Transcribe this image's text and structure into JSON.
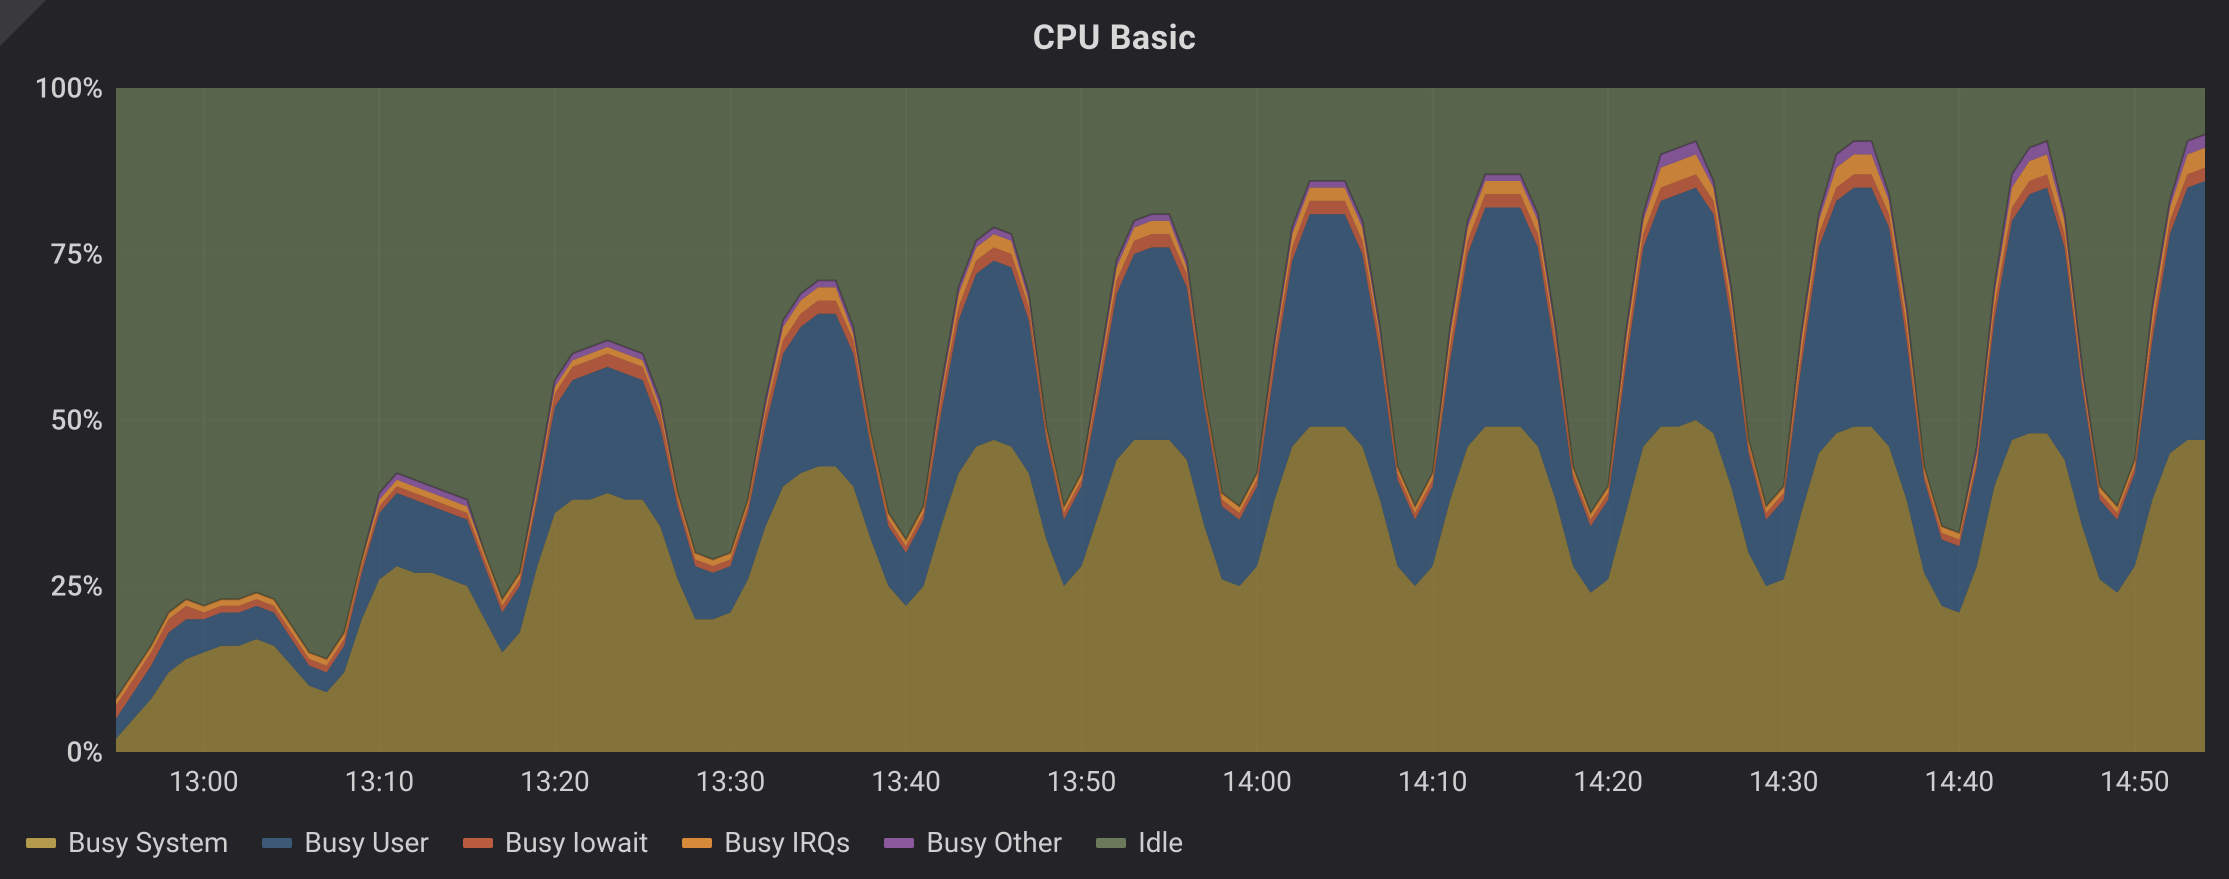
{
  "title": "CPU Basic",
  "legend": [
    {
      "name": "Busy System",
      "color": "#b39a4c"
    },
    {
      "name": "Busy User",
      "color": "#3c5a78"
    },
    {
      "name": "Busy Iowait",
      "color": "#b95b3f"
    },
    {
      "name": "Busy IRQs",
      "color": "#d78a3a"
    },
    {
      "name": "Busy Other",
      "color": "#8a5a9c"
    },
    {
      "name": "Idle",
      "color": "#6b7a5a"
    }
  ],
  "y_ticks": [
    "0%",
    "25%",
    "50%",
    "75%",
    "100%"
  ],
  "x_ticks": [
    "13:00",
    "13:10",
    "13:20",
    "13:30",
    "13:40",
    "13:50",
    "14:00",
    "14:10",
    "14:20",
    "14:30",
    "14:40",
    "14:50"
  ],
  "chart_data": {
    "type": "area",
    "title": "CPU Basic",
    "xlabel": "",
    "ylabel": "",
    "ylim": [
      0,
      100
    ],
    "stacked": true,
    "x": [
      "12:55",
      "12:56",
      "12:57",
      "12:58",
      "12:59",
      "13:00",
      "13:01",
      "13:02",
      "13:03",
      "13:04",
      "13:05",
      "13:06",
      "13:07",
      "13:08",
      "13:09",
      "13:10",
      "13:11",
      "13:12",
      "13:13",
      "13:14",
      "13:15",
      "13:16",
      "13:17",
      "13:18",
      "13:19",
      "13:20",
      "13:21",
      "13:22",
      "13:23",
      "13:24",
      "13:25",
      "13:26",
      "13:27",
      "13:28",
      "13:29",
      "13:30",
      "13:31",
      "13:32",
      "13:33",
      "13:34",
      "13:35",
      "13:36",
      "13:37",
      "13:38",
      "13:39",
      "13:40",
      "13:41",
      "13:42",
      "13:43",
      "13:44",
      "13:45",
      "13:46",
      "13:47",
      "13:48",
      "13:49",
      "13:50",
      "13:51",
      "13:52",
      "13:53",
      "13:54",
      "13:55",
      "13:56",
      "13:57",
      "13:58",
      "13:59",
      "14:00",
      "14:01",
      "14:02",
      "14:03",
      "14:04",
      "14:05",
      "14:06",
      "14:07",
      "14:08",
      "14:09",
      "14:10",
      "14:11",
      "14:12",
      "14:13",
      "14:14",
      "14:15",
      "14:16",
      "14:17",
      "14:18",
      "14:19",
      "14:20",
      "14:21",
      "14:22",
      "14:23",
      "14:24",
      "14:25",
      "14:26",
      "14:27",
      "14:28",
      "14:29",
      "14:30",
      "14:31",
      "14:32",
      "14:33",
      "14:34",
      "14:35",
      "14:36",
      "14:37",
      "14:38",
      "14:39",
      "14:40",
      "14:41",
      "14:42",
      "14:43",
      "14:44",
      "14:45",
      "14:46",
      "14:47",
      "14:48",
      "14:49",
      "14:50",
      "14:51",
      "14:52",
      "14:53",
      "14:54"
    ],
    "series": [
      {
        "name": "Busy System",
        "color": "#8c7a3c",
        "values": [
          2,
          5,
          8,
          12,
          14,
          15,
          16,
          16,
          17,
          16,
          13,
          10,
          9,
          12,
          20,
          26,
          28,
          27,
          27,
          26,
          25,
          20,
          15,
          18,
          28,
          36,
          38,
          38,
          39,
          38,
          38,
          34,
          26,
          20,
          20,
          21,
          26,
          34,
          40,
          42,
          43,
          43,
          40,
          32,
          25,
          22,
          25,
          34,
          42,
          46,
          47,
          46,
          42,
          32,
          25,
          28,
          36,
          44,
          47,
          47,
          47,
          44,
          34,
          26,
          25,
          28,
          38,
          46,
          49,
          49,
          49,
          46,
          38,
          28,
          25,
          28,
          38,
          46,
          49,
          49,
          49,
          46,
          38,
          28,
          24,
          26,
          36,
          46,
          49,
          49,
          50,
          48,
          40,
          30,
          25,
          26,
          36,
          45,
          48,
          49,
          49,
          46,
          38,
          27,
          22,
          21,
          28,
          40,
          47,
          48,
          48,
          44,
          34,
          26,
          24,
          28,
          38,
          45,
          47,
          47
        ]
      },
      {
        "name": "Busy User",
        "color": "#3c5a78",
        "values": [
          3,
          4,
          5,
          6,
          6,
          5,
          5,
          5,
          5,
          5,
          4,
          3,
          3,
          4,
          7,
          10,
          11,
          11,
          10,
          10,
          10,
          8,
          6,
          7,
          10,
          16,
          18,
          19,
          19,
          19,
          18,
          15,
          11,
          8,
          7,
          7,
          10,
          15,
          20,
          22,
          23,
          23,
          20,
          14,
          9,
          8,
          10,
          17,
          23,
          26,
          27,
          27,
          23,
          15,
          10,
          12,
          18,
          25,
          28,
          29,
          29,
          26,
          18,
          11,
          10,
          12,
          20,
          28,
          32,
          32,
          32,
          29,
          22,
          13,
          10,
          12,
          21,
          29,
          33,
          33,
          33,
          30,
          22,
          13,
          10,
          12,
          22,
          30,
          34,
          35,
          35,
          33,
          25,
          15,
          10,
          12,
          22,
          31,
          35,
          36,
          36,
          33,
          24,
          14,
          10,
          10,
          15,
          25,
          33,
          36,
          37,
          32,
          21,
          12,
          11,
          14,
          24,
          33,
          38,
          39
        ]
      },
      {
        "name": "Busy Iowait",
        "color": "#b95b3f",
        "values": [
          2,
          2,
          2,
          2,
          2,
          1,
          1,
          1,
          1,
          1,
          1,
          1,
          1,
          1,
          1,
          1,
          1,
          1,
          1,
          1,
          1,
          1,
          1,
          1,
          1,
          2,
          2,
          2,
          2,
          2,
          2,
          2,
          1,
          1,
          1,
          1,
          1,
          2,
          2,
          2,
          2,
          2,
          2,
          1,
          1,
          1,
          1,
          2,
          2,
          2,
          2,
          2,
          2,
          1,
          1,
          1,
          2,
          2,
          2,
          2,
          2,
          2,
          1,
          1,
          1,
          1,
          2,
          2,
          2,
          2,
          2,
          2,
          2,
          1,
          1,
          1,
          2,
          2,
          2,
          2,
          2,
          2,
          2,
          1,
          1,
          1,
          2,
          2,
          2,
          2,
          2,
          2,
          2,
          1,
          1,
          1,
          2,
          2,
          2,
          2,
          2,
          2,
          2,
          1,
          1,
          1,
          1,
          2,
          2,
          2,
          2,
          2,
          1,
          1,
          1,
          1,
          2,
          2,
          2,
          2
        ]
      },
      {
        "name": "Busy IRQs",
        "color": "#d78a3a",
        "values": [
          1,
          1,
          1,
          1,
          1,
          1,
          1,
          1,
          1,
          1,
          1,
          1,
          1,
          1,
          1,
          1,
          1,
          1,
          1,
          1,
          1,
          1,
          1,
          1,
          1,
          1,
          1,
          1,
          1,
          1,
          1,
          1,
          1,
          1,
          1,
          1,
          1,
          1,
          2,
          2,
          2,
          2,
          1,
          1,
          1,
          1,
          1,
          1,
          2,
          2,
          2,
          2,
          1,
          1,
          1,
          1,
          1,
          2,
          2,
          2,
          2,
          1,
          1,
          1,
          1,
          1,
          1,
          2,
          2,
          2,
          2,
          2,
          1,
          1,
          1,
          1,
          2,
          2,
          2,
          2,
          2,
          2,
          1,
          1,
          1,
          1,
          2,
          2,
          3,
          3,
          3,
          2,
          2,
          1,
          1,
          1,
          2,
          2,
          3,
          3,
          3,
          2,
          2,
          1,
          1,
          1,
          1,
          2,
          3,
          3,
          3,
          2,
          1,
          1,
          1,
          1,
          2,
          2,
          3,
          3
        ]
      },
      {
        "name": "Busy Other",
        "color": "#8a5a9c",
        "values": [
          0,
          0,
          0,
          0,
          0,
          0,
          0,
          0,
          0,
          0,
          0,
          0,
          0,
          0,
          0,
          1,
          1,
          1,
          1,
          1,
          1,
          0,
          0,
          0,
          1,
          1,
          1,
          1,
          1,
          1,
          1,
          1,
          0,
          0,
          0,
          0,
          0,
          1,
          1,
          1,
          1,
          1,
          1,
          0,
          0,
          0,
          0,
          1,
          1,
          1,
          1,
          1,
          1,
          0,
          0,
          0,
          1,
          1,
          1,
          1,
          1,
          1,
          0,
          0,
          0,
          0,
          1,
          1,
          1,
          1,
          1,
          1,
          1,
          0,
          0,
          0,
          1,
          1,
          1,
          1,
          1,
          1,
          1,
          0,
          0,
          0,
          1,
          1,
          2,
          2,
          2,
          1,
          1,
          0,
          0,
          0,
          1,
          1,
          2,
          2,
          2,
          1,
          1,
          0,
          0,
          0,
          1,
          1,
          2,
          2,
          2,
          1,
          1,
          0,
          0,
          0,
          1,
          1,
          2,
          2
        ]
      },
      {
        "name": "Idle",
        "color": "#6b7a5a",
        "values": [
          92,
          88,
          84,
          79,
          77,
          78,
          77,
          77,
          76,
          77,
          81,
          85,
          86,
          82,
          71,
          61,
          58,
          59,
          60,
          61,
          62,
          70,
          77,
          73,
          59,
          44,
          40,
          39,
          38,
          39,
          40,
          47,
          61,
          70,
          71,
          70,
          62,
          47,
          35,
          31,
          29,
          29,
          36,
          52,
          64,
          68,
          63,
          45,
          30,
          23,
          21,
          22,
          31,
          51,
          63,
          58,
          42,
          26,
          20,
          19,
          19,
          26,
          46,
          61,
          63,
          58,
          38,
          21,
          14,
          14,
          14,
          20,
          36,
          57,
          63,
          58,
          36,
          20,
          13,
          13,
          13,
          19,
          36,
          57,
          64,
          60,
          37,
          19,
          10,
          9,
          8,
          14,
          30,
          53,
          63,
          60,
          37,
          19,
          10,
          8,
          8,
          16,
          33,
          57,
          66,
          67,
          54,
          30,
          13,
          9,
          8,
          19,
          42,
          60,
          63,
          56,
          33,
          17,
          8,
          7
        ]
      }
    ]
  }
}
